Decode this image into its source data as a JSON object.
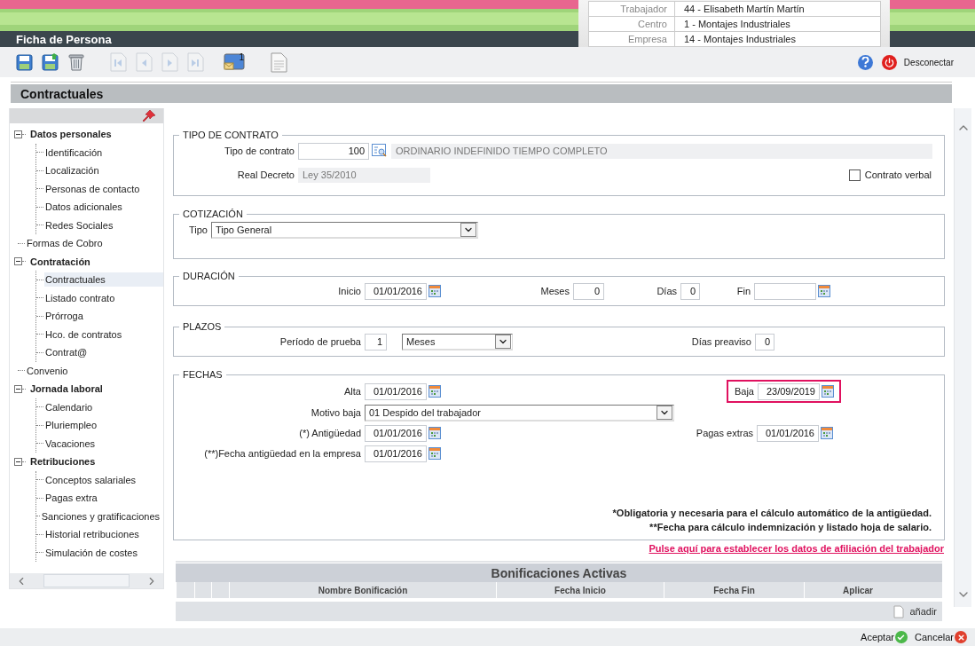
{
  "header": {
    "title": "Ficha de Persona",
    "info": [
      {
        "label": "Trabajador",
        "value": "44 - Elisabeth Martín Martín"
      },
      {
        "label": "Centro",
        "value": "1 - Montajes Industriales"
      },
      {
        "label": "Empresa",
        "value": "14 - Montajes Industriales"
      }
    ]
  },
  "toolbar": {
    "groups": [
      [
        {
          "kind": "save",
          "disabled": false
        },
        {
          "kind": "save_as",
          "disabled": false
        },
        {
          "kind": "delete",
          "disabled": false
        }
      ],
      [
        {
          "kind": "first",
          "disabled": true
        },
        {
          "kind": "previous",
          "disabled": true
        },
        {
          "kind": "next",
          "disabled": true
        },
        {
          "kind": "last",
          "disabled": true
        }
      ],
      [
        {
          "kind": "messages",
          "disabled": false,
          "badge": "1"
        }
      ],
      [
        {
          "kind": "document",
          "disabled": false
        }
      ]
    ],
    "disconnect": "Desconectar"
  },
  "page_title": "Contractuales",
  "sidebar": {
    "tree": [
      {
        "label": "Datos personales",
        "expanded": true,
        "children": [
          {
            "label": "Identificación",
            "selected": false
          },
          {
            "label": "Localización",
            "selected": false
          },
          {
            "label": "Personas de contacto",
            "selected": false
          },
          {
            "label": "Datos adicionales",
            "selected": false
          },
          {
            "label": "Redes Sociales",
            "selected": false
          }
        ]
      },
      {
        "label": "Formas de Cobro",
        "selected": false
      },
      {
        "label": "Contratación",
        "expanded": true,
        "children": [
          {
            "label": "Contractuales",
            "selected": true
          },
          {
            "label": "Listado contrato",
            "selected": false
          },
          {
            "label": "Prórroga",
            "selected": false
          },
          {
            "label": "Hco. de contratos",
            "selected": false
          },
          {
            "label": "Contrat@",
            "selected": false
          }
        ]
      },
      {
        "label": "Convenio",
        "selected": false
      },
      {
        "label": "Jornada laboral",
        "expanded": true,
        "children": [
          {
            "label": "Calendario",
            "selected": false
          },
          {
            "label": "Pluriempleo",
            "selected": false
          },
          {
            "label": "Vacaciones",
            "selected": false
          }
        ]
      },
      {
        "label": "Retribuciones",
        "expanded": true,
        "children": [
          {
            "label": "Conceptos salariales",
            "selected": false
          },
          {
            "label": "Pagas extra",
            "selected": false
          },
          {
            "label": "Sanciones y gratificaciones",
            "selected": false
          },
          {
            "label": "Historial retribuciones",
            "selected": false
          },
          {
            "label": "Simulación de costes",
            "selected": false
          }
        ]
      }
    ]
  },
  "form": {
    "tipo_contrato": {
      "legend": "TIPO DE CONTRATO",
      "tipo_label": "Tipo de contrato",
      "tipo_value": "100",
      "tipo_description": "ORDINARIO INDEFINIDO TIEMPO COMPLETO",
      "decreto_label": "Real Decreto",
      "decreto_value": "Ley 35/2010",
      "verbal": {
        "label": "Contrato verbal",
        "checked": false
      }
    },
    "cotizacion": {
      "legend": "COTIZACIÓN",
      "tipo_label": "Tipo",
      "tipo_value": "Tipo General"
    },
    "duracion": {
      "legend": "DURACIÓN",
      "inicio": {
        "label": "Inicio",
        "value": "01/01/2016"
      },
      "meses": {
        "label": "Meses",
        "value": "0"
      },
      "dias": {
        "label": "Días",
        "value": "0"
      },
      "fin": {
        "label": "Fin"
      }
    },
    "plazos": {
      "legend": "PLAZOS",
      "periodo": {
        "label": "Período de prueba",
        "value": "1",
        "unit": "Meses"
      },
      "preaviso": {
        "label": "Días preaviso",
        "value": "0"
      }
    },
    "fechas": {
      "legend": "FECHAS",
      "alta": {
        "label": "Alta",
        "value": "01/01/2016"
      },
      "baja": {
        "label": "Baja",
        "value": "23/09/2019",
        "highlighted": true
      },
      "motivo": {
        "label": "Motivo baja",
        "value": "01 Despido del trabajador"
      },
      "antiguedad": {
        "label": "(*) Antigüedad",
        "value": "01/01/2016"
      },
      "pagas": {
        "label": "Pagas extras",
        "value": "01/01/2016"
      },
      "antiguedad_empresa": {
        "label": "(**)Fecha antigüedad en la empresa",
        "value": "01/01/2016"
      },
      "notes": [
        "*Obligatoria y necesaria para el cálculo automático de la antigüedad.",
        "**Fecha para cálculo indemnización y listado hoja de salario."
      ]
    }
  },
  "affiliation_link": "Pulse aquí para establecer los datos de afiliación del trabajador",
  "bonificaciones": {
    "title": "Bonificaciones Activas",
    "columns": [
      "Nombre Bonificación",
      "Fecha Inicio",
      "Fecha Fin",
      "Aplicar"
    ],
    "add_label": "añadir"
  },
  "footer": {
    "buttons": [
      {
        "label": "Aceptar",
        "kind": "accept"
      },
      {
        "label": "Cancelar",
        "kind": "cancel"
      }
    ]
  }
}
